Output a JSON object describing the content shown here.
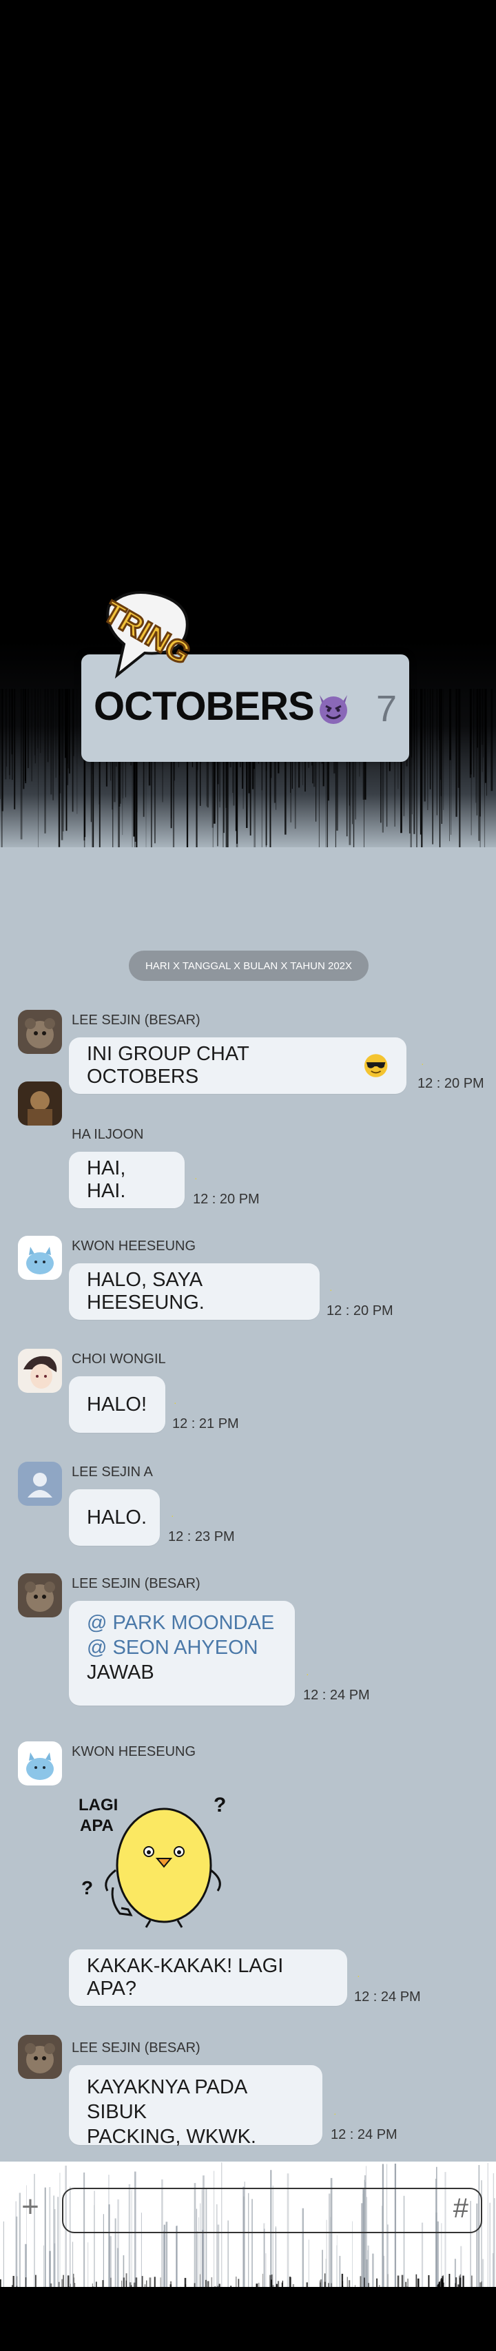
{
  "chat": {
    "title": "OCTOBERS",
    "title_emoji": "smiling-devil-emoji",
    "member_count": "7",
    "sound_effect": "TRING",
    "date_divider": "HARI X TANGGAL X BULAN X TAHUN 202X"
  },
  "messages": [
    {
      "sender": "LEE SEJIN (BESAR)",
      "avatar": "bear-photo-avatar",
      "text": "INI GROUP CHAT OCTOBERS",
      "emoji": "sunglasses-emoji",
      "time": "12 : 20 PM"
    },
    {
      "sender": "HA ILJOON",
      "avatar": "dark-photo-avatar",
      "text": "HAI, HAI.",
      "time": "12 : 20 PM"
    },
    {
      "sender": "KWON HEESEUNG",
      "avatar": "blue-cat-avatar",
      "text": "HALO, SAYA HEESEUNG.",
      "time": "12 : 20 PM"
    },
    {
      "sender": "CHOI WONGIL",
      "avatar": "anime-avatar",
      "text": "HALO!",
      "time": "12 : 21 PM"
    },
    {
      "sender": "LEE SEJIN A",
      "avatar": "default-user-avatar",
      "text": "HALO.",
      "time": "12 : 23 PM"
    },
    {
      "sender": "LEE SEJIN (BESAR)",
      "avatar": "bear-photo-avatar",
      "mention_1": "@ PARK MOONDAE",
      "mention_2": "@ SEON AHYEON",
      "text": "JAWAB",
      "time": "12 : 24 PM"
    },
    {
      "sender": "KWON HEESEUNG",
      "avatar": "blue-cat-avatar",
      "sticker_text": "LAGI\nAPA",
      "text": "KAKAK-KAKAK! LAGI APA?",
      "time": "12 : 24 PM"
    },
    {
      "sender": "LEE SEJIN (BESAR)",
      "avatar": "bear-photo-avatar",
      "text_line_1": "KAYAKNYA PADA SIBUK",
      "text_line_2": "PACKING, WKWK.",
      "time": "12 : 24 PM"
    }
  ],
  "input": {
    "plus_label": "+",
    "placeholder": "",
    "hash_label": "#"
  },
  "colors": {
    "chat_background": "#b8c3cc",
    "bubble": "#eef2f6",
    "mention": "#4a78a8",
    "date_pill": "#8f969d"
  }
}
